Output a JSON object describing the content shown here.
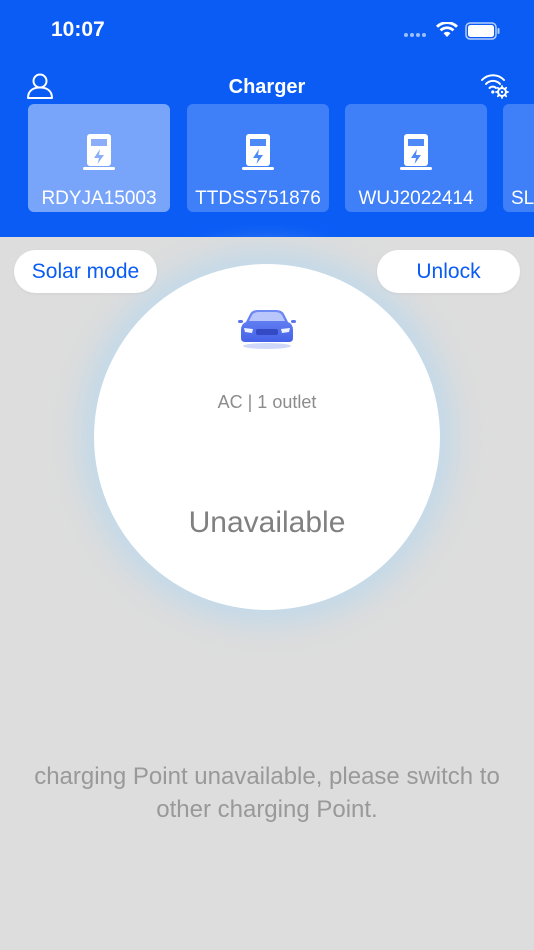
{
  "status_bar": {
    "time": "10:07"
  },
  "header": {
    "title": "Charger",
    "profile_icon": "user-profile-icon",
    "network_icon": "wifi-settings-icon"
  },
  "chargers": [
    {
      "id": "RDYJA15003",
      "selected": true
    },
    {
      "id": "TTDSS751876",
      "selected": false
    },
    {
      "id": "WUJ2022414",
      "selected": false
    },
    {
      "id": "SL",
      "selected": false
    }
  ],
  "controls": {
    "solar_mode_label": "Solar mode",
    "unlock_label": "Unlock"
  },
  "charger_status": {
    "outlet_info": "AC | 1 outlet",
    "status": "Unavailable"
  },
  "message": {
    "line1": "charging Point unavailable, please switch to",
    "line2": "other charging Point."
  },
  "colors": {
    "primary": "#0a5cf5",
    "background": "#dddddd",
    "card_bg": "#ffffff",
    "muted_text": "#999999"
  }
}
